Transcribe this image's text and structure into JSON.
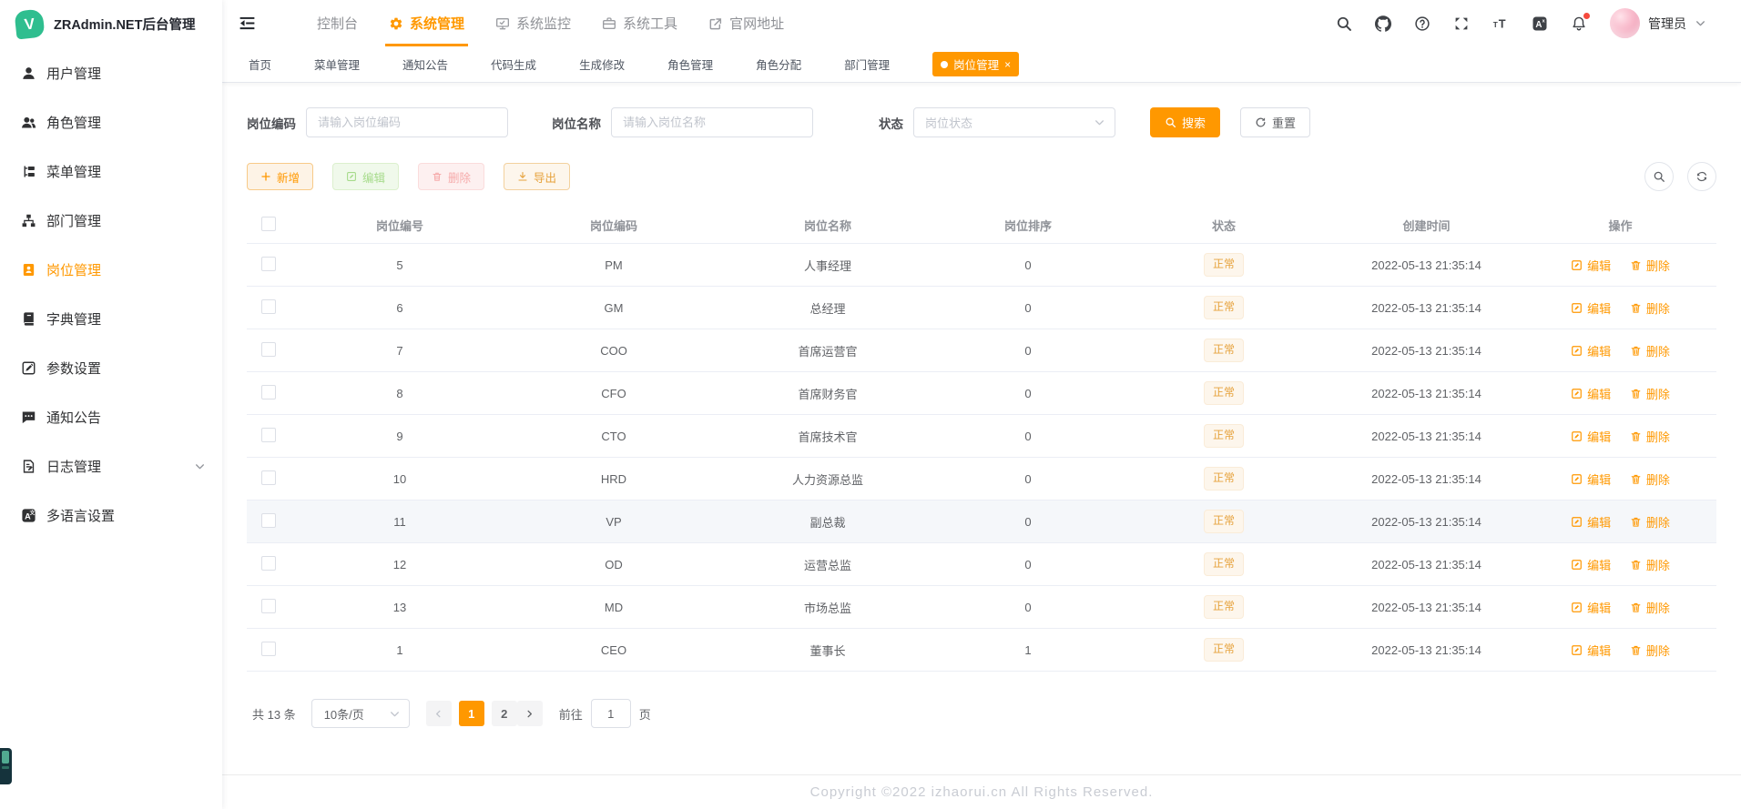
{
  "colors": {
    "accent": "#ff9800",
    "warning": "#e6a23c",
    "success": "#67c23a",
    "danger": "#f56c6c",
    "logo_green": "#2fbe8f"
  },
  "app": {
    "title": "ZRAdmin.NET后台管理",
    "logo_letter": "V"
  },
  "topnav": {
    "items": [
      {
        "label": "控制台",
        "icon": "",
        "active": false
      },
      {
        "label": "系统管理",
        "icon": "gear-icon",
        "active": true
      },
      {
        "label": "系统监控",
        "icon": "monitor-icon",
        "active": false
      },
      {
        "label": "系统工具",
        "icon": "toolbox-icon",
        "active": false
      },
      {
        "label": "官网地址",
        "icon": "external-link-icon",
        "active": false
      }
    ],
    "right_icons": [
      {
        "icon": "search-icon",
        "badge": false
      },
      {
        "icon": "github-icon",
        "badge": false
      },
      {
        "icon": "help-icon",
        "badge": false
      },
      {
        "icon": "fullscreen-icon",
        "badge": false
      },
      {
        "icon": "font-size-icon",
        "badge": false
      },
      {
        "icon": "language-icon",
        "badge": false
      },
      {
        "icon": "bell-icon",
        "badge": true
      }
    ],
    "user": {
      "name": "管理员"
    }
  },
  "tabs": [
    {
      "label": "首页",
      "active": false
    },
    {
      "label": "菜单管理",
      "active": false
    },
    {
      "label": "通知公告",
      "active": false
    },
    {
      "label": "代码生成",
      "active": false
    },
    {
      "label": "生成修改",
      "active": false
    },
    {
      "label": "角色管理",
      "active": false
    },
    {
      "label": "角色分配",
      "active": false
    },
    {
      "label": "部门管理",
      "active": false
    },
    {
      "label": "岗位管理",
      "active": true,
      "close": "×"
    }
  ],
  "sidebar": {
    "items": [
      {
        "label": "用户管理",
        "icon": "user-icon",
        "active": false,
        "expandable": false
      },
      {
        "label": "角色管理",
        "icon": "roles-icon",
        "active": false,
        "expandable": false
      },
      {
        "label": "菜单管理",
        "icon": "menu-icon",
        "active": false,
        "expandable": false
      },
      {
        "label": "部门管理",
        "icon": "dept-icon",
        "active": false,
        "expandable": false
      },
      {
        "label": "岗位管理",
        "icon": "post-icon",
        "active": true,
        "expandable": false
      },
      {
        "label": "字典管理",
        "icon": "dict-icon",
        "active": false,
        "expandable": false
      },
      {
        "label": "参数设置",
        "icon": "params-icon",
        "active": false,
        "expandable": false
      },
      {
        "label": "通知公告",
        "icon": "notice-icon",
        "active": false,
        "expandable": false
      },
      {
        "label": "日志管理",
        "icon": "log-icon",
        "active": false,
        "expandable": true
      },
      {
        "label": "多语言设置",
        "icon": "i18n-icon",
        "active": false,
        "expandable": false
      }
    ]
  },
  "filters": {
    "code_label": "岗位编码",
    "code_placeholder": "请输入岗位编码",
    "name_label": "岗位名称",
    "name_placeholder": "请输入岗位名称",
    "status_label": "状态",
    "status_placeholder": "岗位状态",
    "search_label": "搜索",
    "reset_label": "重置"
  },
  "toolbar": {
    "add_label": "新增",
    "edit_label": "编辑",
    "delete_label": "删除",
    "export_label": "导出"
  },
  "table": {
    "columns": [
      "岗位编号",
      "岗位编码",
      "岗位名称",
      "岗位排序",
      "状态",
      "创建时间",
      "操作"
    ],
    "edit_label": "编辑",
    "delete_label": "删除",
    "rows": [
      {
        "id": "5",
        "code": "PM",
        "name": "人事经理",
        "sort": "0",
        "status": "正常",
        "created": "2022-05-13 21:35:14",
        "highlighted": false
      },
      {
        "id": "6",
        "code": "GM",
        "name": "总经理",
        "sort": "0",
        "status": "正常",
        "created": "2022-05-13 21:35:14",
        "highlighted": false
      },
      {
        "id": "7",
        "code": "COO",
        "name": "首席运营官",
        "sort": "0",
        "status": "正常",
        "created": "2022-05-13 21:35:14",
        "highlighted": false
      },
      {
        "id": "8",
        "code": "CFO",
        "name": "首席财务官",
        "sort": "0",
        "status": "正常",
        "created": "2022-05-13 21:35:14",
        "highlighted": false
      },
      {
        "id": "9",
        "code": "CTO",
        "name": "首席技术官",
        "sort": "0",
        "status": "正常",
        "created": "2022-05-13 21:35:14",
        "highlighted": false
      },
      {
        "id": "10",
        "code": "HRD",
        "name": "人力资源总监",
        "sort": "0",
        "status": "正常",
        "created": "2022-05-13 21:35:14",
        "highlighted": false
      },
      {
        "id": "11",
        "code": "VP",
        "name": "副总裁",
        "sort": "0",
        "status": "正常",
        "created": "2022-05-13 21:35:14",
        "highlighted": true
      },
      {
        "id": "12",
        "code": "OD",
        "name": "运营总监",
        "sort": "0",
        "status": "正常",
        "created": "2022-05-13 21:35:14",
        "highlighted": false
      },
      {
        "id": "13",
        "code": "MD",
        "name": "市场总监",
        "sort": "0",
        "status": "正常",
        "created": "2022-05-13 21:35:14",
        "highlighted": false
      },
      {
        "id": "1",
        "code": "CEO",
        "name": "董事长",
        "sort": "1",
        "status": "正常",
        "created": "2022-05-13 21:35:14",
        "highlighted": false
      }
    ]
  },
  "pagination": {
    "total_label": "共 13 条",
    "page_size": "10条/页",
    "pages": [
      {
        "label": "1",
        "active": true
      },
      {
        "label": "2",
        "active": false
      }
    ],
    "goto_label": "前往",
    "goto_value": "1",
    "unit_label": "页"
  },
  "footer": {
    "copyright": "Copyright ©2022 izhaorui.cn All Rights Reserved."
  }
}
